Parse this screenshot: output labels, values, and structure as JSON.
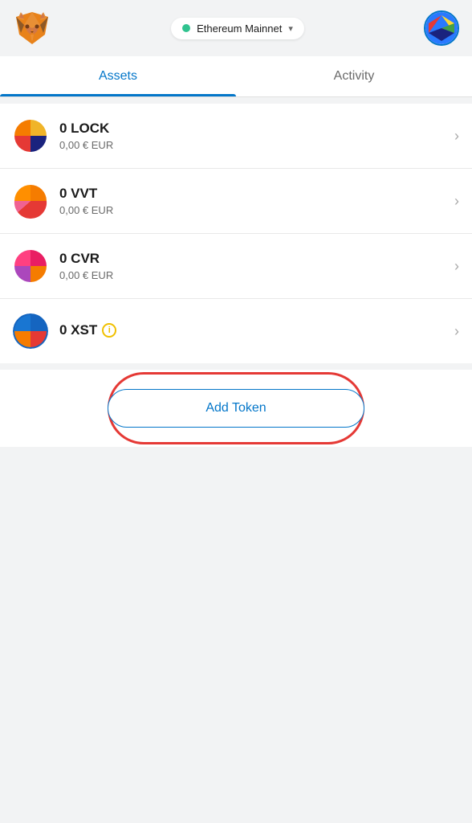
{
  "header": {
    "network_name": "Ethereum Mainnet",
    "network_dot_color": "#30c38f"
  },
  "tabs": [
    {
      "id": "assets",
      "label": "Assets",
      "active": true
    },
    {
      "id": "activity",
      "label": "Activity",
      "active": false
    }
  ],
  "tokens": [
    {
      "symbol": "LOCK",
      "amount": "0 LOCK",
      "value": "0,00 € EUR",
      "has_info": false
    },
    {
      "symbol": "VVT",
      "amount": "0 VVT",
      "value": "0,00 € EUR",
      "has_info": false
    },
    {
      "symbol": "CVR",
      "amount": "0 CVR",
      "value": "0,00 € EUR",
      "has_info": false
    },
    {
      "symbol": "XST",
      "amount": "0 XST",
      "value": "",
      "has_info": true
    }
  ],
  "add_token_button": {
    "label": "Add Token"
  }
}
